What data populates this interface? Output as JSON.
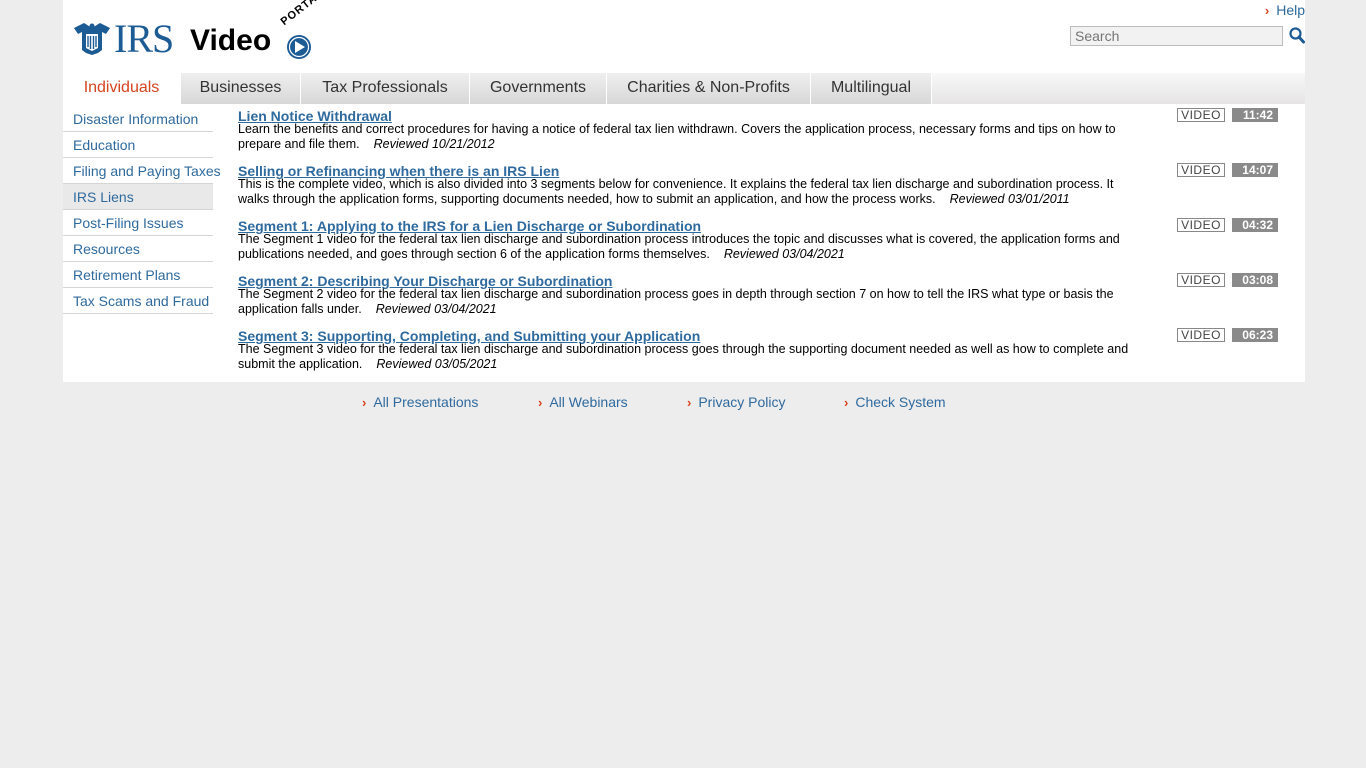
{
  "header": {
    "logo_irs": "IRS",
    "logo_video": "Video",
    "logo_portal": "PORTAL",
    "help_label": "Help",
    "search_placeholder": "Search"
  },
  "nav": {
    "tabs": [
      {
        "label": "Individuals",
        "active": true
      },
      {
        "label": "Businesses"
      },
      {
        "label": "Tax Professionals"
      },
      {
        "label": "Governments"
      },
      {
        "label": "Charities & Non-Profits"
      },
      {
        "label": "Multilingual"
      }
    ]
  },
  "sidebar": {
    "items": [
      {
        "label": "Disaster Information"
      },
      {
        "label": "Education"
      },
      {
        "label": "Filing and Paying Taxes"
      },
      {
        "label": "IRS Liens",
        "active": true
      },
      {
        "label": "Post-Filing Issues"
      },
      {
        "label": "Resources"
      },
      {
        "label": "Retirement Plans"
      },
      {
        "label": "Tax Scams and Fraud"
      }
    ]
  },
  "videos": [
    {
      "title": "Lien Notice Withdrawal",
      "description": "Learn the benefits and correct procedures for having a notice of federal tax lien withdrawn. Covers the application process, necessary forms and tips on how to prepare and file them.",
      "reviewed": "Reviewed 10/21/2012",
      "tag": "VIDEO",
      "duration": "11:42"
    },
    {
      "title": "Selling or Refinancing when there is an IRS Lien",
      "description": "This is the complete video, which is also divided into 3 segments below for convenience. It explains the federal tax lien discharge and subordination process. It walks through the application forms, supporting documents needed, how to submit an application, and how the process works.",
      "reviewed": "Reviewed 03/01/2011",
      "tag": "VIDEO",
      "duration": "14:07"
    },
    {
      "title": "Segment 1: Applying to the IRS for a Lien Discharge or Subordination",
      "description": "The Segment 1 video for the federal tax lien discharge and subordination process introduces the topic and discusses what is covered, the application forms and publications needed, and goes through section 6 of the application forms themselves.",
      "reviewed": "Reviewed 03/04/2021",
      "tag": "VIDEO",
      "duration": "04:32"
    },
    {
      "title": "Segment 2: Describing Your Discharge or Subordination",
      "description": "The Segment 2 video for the federal tax lien discharge and subordination process goes in depth through section 7 on how to tell the IRS what type or basis the application falls under.",
      "reviewed": "Reviewed 03/04/2021",
      "tag": "VIDEO",
      "duration": "03:08"
    },
    {
      "title": "Segment 3: Supporting, Completing, and Submitting your Application",
      "description": "The Segment 3 video for the federal tax lien discharge and subordination process goes through the supporting document needed as well as how to complete and submit the application.",
      "reviewed": "Reviewed 03/05/2021",
      "tag": "VIDEO",
      "duration": "06:23"
    }
  ],
  "footer": {
    "links": [
      {
        "label": "All Presentations"
      },
      {
        "label": "All Webinars"
      },
      {
        "label": "Privacy Policy"
      },
      {
        "label": "Check System"
      }
    ]
  },
  "colors": {
    "link": "#2f6a9e",
    "accent": "#d5441d",
    "page_bg": "#ededed",
    "duration_bg": "#8a8a8a"
  }
}
